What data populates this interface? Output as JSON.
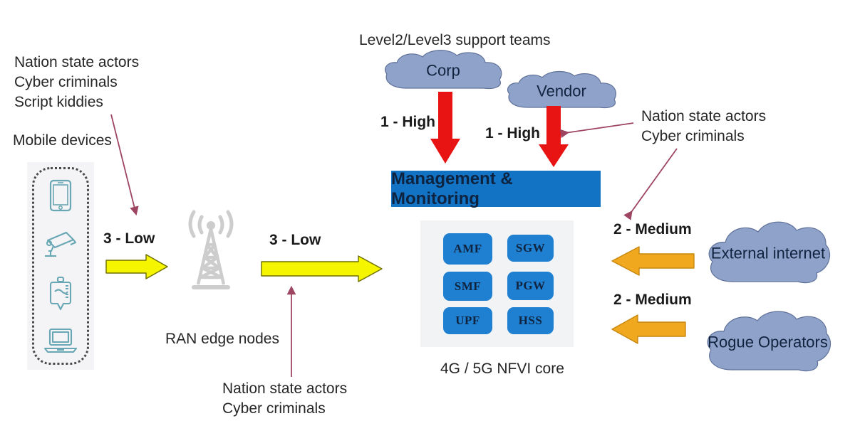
{
  "diagram": {
    "title": "5G network threat surface diagram",
    "colors": {
      "red_arrow": "#e81313",
      "orange_arrow": "#f0a81e",
      "yellow_arrow": "#f5f500",
      "cloud_fill": "#8fa3ca",
      "core_box": "#1f7fd0",
      "mgmt_box": "#1273c4",
      "connector": "#9e4562",
      "tower_gray": "#cccccc",
      "text": "#262626"
    }
  },
  "left": {
    "threat_actors": "Nation state actors\nCyber criminals\nScript kiddies",
    "mobile_devices_label": "Mobile devices",
    "devices": [
      {
        "name": "tablet-icon"
      },
      {
        "name": "security-camera-icon"
      },
      {
        "name": "iv-drip-icon"
      },
      {
        "name": "laptop-icon"
      }
    ]
  },
  "ran": {
    "label": "RAN edge nodes",
    "threat_actors": "Nation state actors\nCyber criminals",
    "risk_left": "3 - Low",
    "risk_right": "3 - Low"
  },
  "top": {
    "support_teams_label": "Level2/Level3 support teams",
    "corp_cloud": "Corp",
    "vendor_cloud": "Vendor",
    "risk_corp": "1 - High",
    "risk_vendor": "1 - High",
    "management_box": "Management & Monitoring"
  },
  "core": {
    "caption": "4G / 5G NFVI core",
    "functions_left": [
      "AMF",
      "SMF",
      "UPF"
    ],
    "functions_right": [
      "SGW",
      "PGW",
      "HSS"
    ]
  },
  "right": {
    "threat_actors": "Nation state actors\nCyber criminals",
    "external_internet_cloud": "External\ninternet",
    "rogue_operators_cloud": "Rogue\nOperators",
    "risk_internet": "2 - Medium",
    "risk_rogue": "2 - Medium"
  }
}
